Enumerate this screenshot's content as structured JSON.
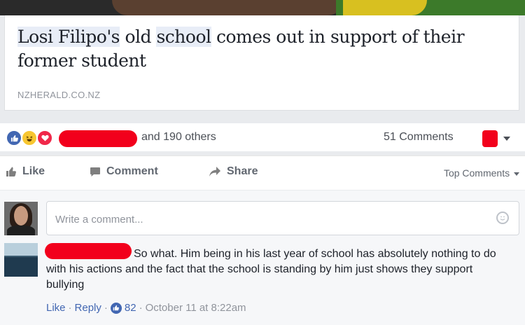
{
  "link": {
    "title_parts": [
      "Losi Filipo's",
      " old ",
      "school",
      " comes out in support of their former student"
    ],
    "domain": "NZHERALD.CO.NZ"
  },
  "reactions": {
    "others_text": "and 190 others",
    "comments_count": "51 Comments"
  },
  "actions": {
    "like": "Like",
    "comment": "Comment",
    "share": "Share",
    "sort": "Top Comments"
  },
  "composer": {
    "placeholder": "Write a comment..."
  },
  "comment": {
    "text": "So what. Him being in his last year of school has absolutely nothing to do with his actions and the fact that the school is standing by him just shows they support bullying",
    "like_label": "Like",
    "reply_label": "Reply",
    "like_count": "82",
    "timestamp": "October 11 at 8:22am",
    "separator": "·"
  },
  "icons": {
    "like": "thumbs-up-icon",
    "haha": "laughing-face-icon",
    "love": "heart-icon",
    "comment": "speech-bubble-icon",
    "share": "share-arrow-icon",
    "smile": "smiley-icon",
    "caret": "caret-down-icon"
  },
  "colors": {
    "brand_blue": "#4267b2",
    "redaction": "#f2001c",
    "love": "#f0284a",
    "haha": "#f7c631"
  }
}
